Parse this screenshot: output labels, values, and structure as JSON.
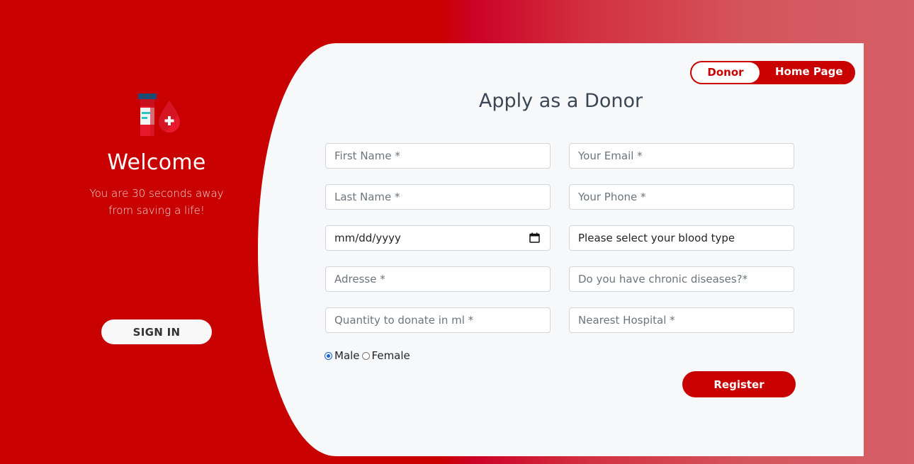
{
  "sidebar": {
    "logo_icon": "blood-donation-icon",
    "welcome": "Welcome",
    "tagline_line1": "You are 30 seconds away",
    "tagline_line2": "from saving a life!",
    "signin_label": "SIGN IN"
  },
  "toggle": {
    "donor_label": "Donor",
    "home_label": "Home Page"
  },
  "form": {
    "title": "Apply as a Donor",
    "first_name_placeholder": "First Name *",
    "email_placeholder": "Your Email *",
    "last_name_placeholder": "Last Name *",
    "phone_placeholder": "Your Phone *",
    "date_placeholder": "mm/dd/yyyy",
    "blood_type_value": "Please select your blood type",
    "address_placeholder": "Adresse *",
    "chronic_placeholder": "Do you have chronic diseases?*",
    "quantity_placeholder": "Quantity to donate in ml *",
    "hospital_placeholder": "Nearest Hospital *",
    "gender_male": "Male",
    "gender_female": "Female",
    "gender_selected": "Male",
    "register_label": "Register"
  },
  "colors": {
    "primary_red": "#c80000",
    "card_bg": "#f7f8fa"
  }
}
